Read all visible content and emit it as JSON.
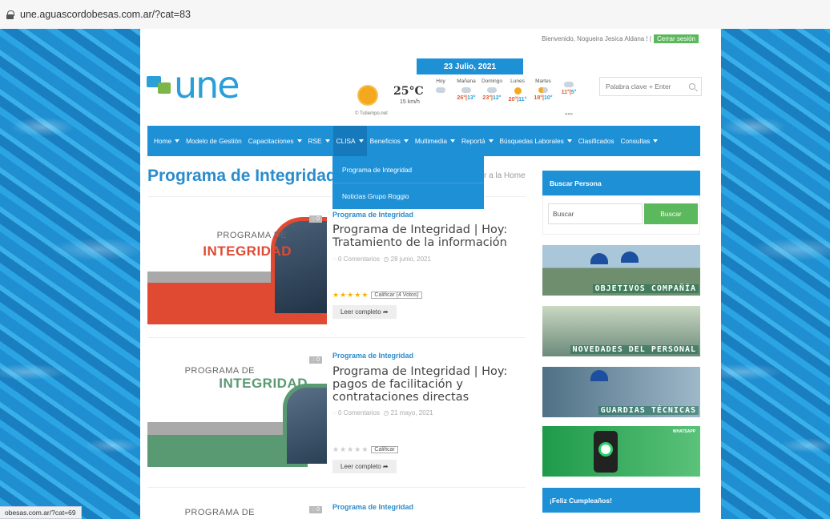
{
  "browser": {
    "url": "une.aguascordobesas.com.ar/?cat=83"
  },
  "header": {
    "welcome": "Bienvenido, Nogueira Jesica Aldana ! |",
    "logout": "Cerrar sesión",
    "logo_text": "une",
    "date": "23 Julio, 2021",
    "search_placeholder": "Palabra clave + Enter"
  },
  "weather": {
    "temp": "25°C",
    "wind": "15 km/h",
    "credit": "© Tutiempo.net",
    "more": "»»»",
    "days": [
      {
        "name": "Hoy",
        "icon": "cloud-icon",
        "max": "",
        "min": ""
      },
      {
        "name": "Mañana",
        "icon": "cloud-icon",
        "max": "26°",
        "min": "13°"
      },
      {
        "name": "Domingo",
        "icon": "sun-icon",
        "max": "23°",
        "min": "12°"
      },
      {
        "name": "Lunes",
        "icon": "partly-cloudy-icon",
        "max": "20°",
        "min": "11°"
      },
      {
        "name": "Martes",
        "icon": "cloud-icon",
        "max": "18°",
        "min": "10°"
      },
      {
        "name": "",
        "icon": "",
        "max": "11°",
        "min": "5°"
      }
    ]
  },
  "nav": {
    "items": [
      {
        "label": "Home"
      },
      {
        "label": "Modelo de Gestión"
      },
      {
        "label": "Capacitaciones"
      },
      {
        "label": "RSE"
      },
      {
        "label": "CLISA"
      },
      {
        "label": "Beneficios"
      },
      {
        "label": "Multimedia"
      },
      {
        "label": "Reportá"
      },
      {
        "label": "Búsquedas Laborales"
      },
      {
        "label": "Clasificados"
      },
      {
        "label": "Consultas"
      }
    ],
    "dropdown": [
      "Programa de Integridad",
      "Noticias Grupo Roggio"
    ]
  },
  "main": {
    "title": "Programa de Integridad",
    "back_fragment": "r a la Home",
    "articles": [
      {
        "category": "Programa de Integridad",
        "title": "Programa de Integridad | Hoy: Tratamiento de la información",
        "comments": "0 Comentarios",
        "date": "28 junio, 2021",
        "rate_label": "Calificar (4 Votos)",
        "rating": 5,
        "read_more": "Leer completo",
        "img_line1": "PROGRAMA DE",
        "img_line2": "INTEGRIDAD",
        "comment_badge": "0"
      },
      {
        "category": "Programa de Integridad",
        "title": "Programa de Integridad | Hoy: pagos de facilitación y contrataciones directas",
        "comments": "0 Comentarios",
        "date": "21 mayo, 2021",
        "rate_label": "Calificar",
        "rating": 0,
        "read_more": "Leer completo",
        "img_line1": "PROGRAMA DE",
        "img_line2": "INTEGRIDAD",
        "comment_badge": "0"
      },
      {
        "category": "Programa de Integridad",
        "img_line1": "PROGRAMA DE",
        "comment_badge": "0"
      }
    ]
  },
  "sidebar": {
    "search_title": "Buscar Persona",
    "search_placeholder": "Buscar",
    "search_button": "Buscar",
    "banners": [
      "OBJETIVOS COMPAÑÍA",
      "NOVEDADES DEL PERSONAL",
      "GUARDIAS TÉCNICAS",
      "WHATSAPP"
    ],
    "birthday_title": "¡Feliz Cumpleaños!"
  },
  "status_bar": "obesas.com.ar/?cat=69"
}
